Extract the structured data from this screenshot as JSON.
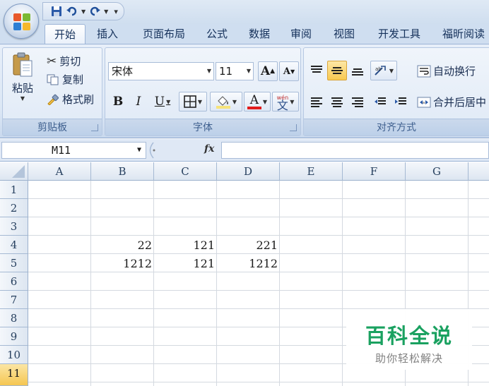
{
  "quick_access": {
    "save": "save-icon",
    "undo": "undo-icon",
    "redo": "redo-icon"
  },
  "tabs": [
    "开始",
    "插入",
    "页面布局",
    "公式",
    "数据",
    "审阅",
    "视图",
    "开发工具",
    "福昕阅读"
  ],
  "clipboard": {
    "paste": "粘贴",
    "cut": "剪切",
    "copy": "复制",
    "format_painter": "格式刷",
    "label": "剪贴板"
  },
  "font": {
    "name": "宋体",
    "size": "11",
    "grow": "A",
    "shrink": "A",
    "bold": "B",
    "italic": "I",
    "underline": "U",
    "color_letter": "A",
    "phonetic": "wén",
    "phonetic_char": "文",
    "label": "字体"
  },
  "alignment": {
    "wrap_text": "自动换行",
    "merge_center": "合并后居中",
    "label": "对齐方式"
  },
  "formula_bar": {
    "name_box": "M11",
    "fx": "fx",
    "content": ""
  },
  "columns": [
    "A",
    "B",
    "C",
    "D",
    "E",
    "F",
    "G"
  ],
  "rows": [
    "1",
    "2",
    "3",
    "4",
    "5",
    "6",
    "7",
    "8",
    "9",
    "10",
    "11"
  ],
  "selected_row": "11",
  "cells": [
    {
      "ref": "B4",
      "value": "22"
    },
    {
      "ref": "C4",
      "value": "121"
    },
    {
      "ref": "D4",
      "value": "221"
    },
    {
      "ref": "B5",
      "value": "1212"
    },
    {
      "ref": "C5",
      "value": "121"
    },
    {
      "ref": "D5",
      "value": "1212"
    }
  ],
  "watermark": {
    "title": "百科全说",
    "subtitle": "助你轻松解决"
  },
  "colors": {
    "accent_green": "#1aa160",
    "selected_row": "#f8c94f",
    "ribbon": "#dce7f5"
  }
}
